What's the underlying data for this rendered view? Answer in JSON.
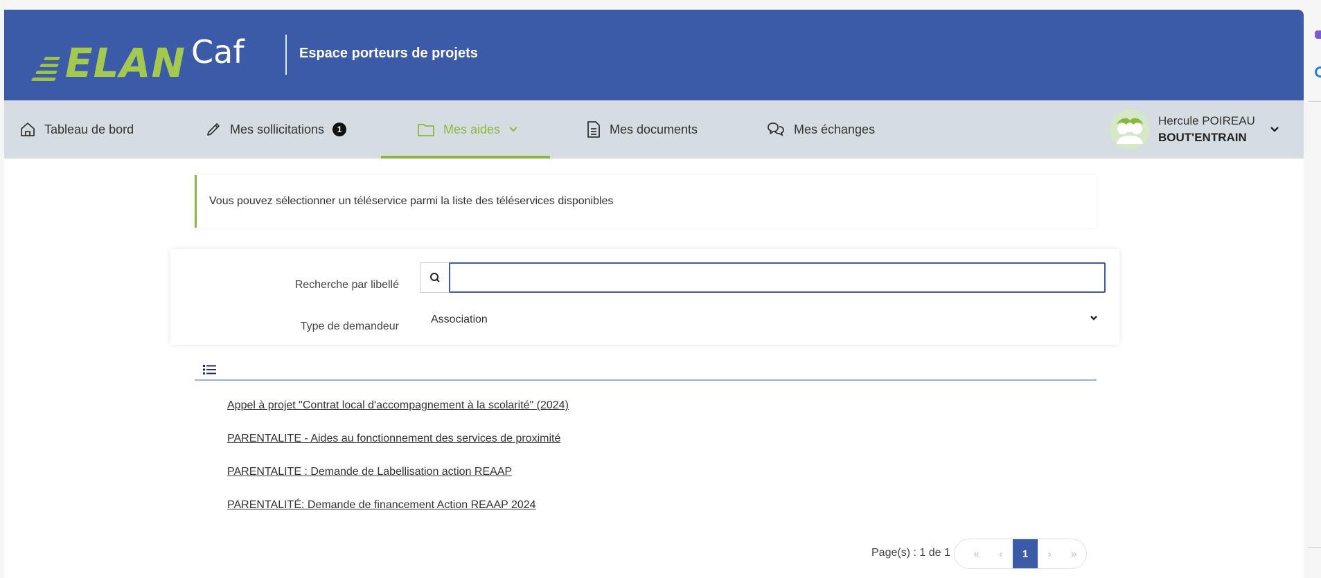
{
  "header": {
    "logo_elan": "ELAN",
    "logo_caf": "Caf",
    "title": "Espace porteurs de projets"
  },
  "nav": {
    "items": [
      {
        "label": "Tableau de bord",
        "icon": "home-icon"
      },
      {
        "label": "Mes sollicitations",
        "icon": "pen-icon",
        "badge": "1"
      },
      {
        "label": "Mes aides",
        "icon": "folder-icon",
        "active": true
      },
      {
        "label": "Mes documents",
        "icon": "document-icon"
      },
      {
        "label": "Mes échanges",
        "icon": "chat-icon"
      }
    ],
    "user": {
      "first_line": "Hercule POIREAU",
      "second_line": "BOUT'ENTRAIN"
    }
  },
  "info": {
    "message": "Vous pouvez sélectionner un téléservice parmi la liste des téléservices disponibles"
  },
  "search": {
    "label": "Recherche par libellé",
    "value": "",
    "type_label": "Type de demandeur",
    "type_value": "Association"
  },
  "list": {
    "items": [
      "Appel à projet \"Contrat local d'accompagnement à la scolarité\" (2024)",
      "PARENTALITE - Aides au fonctionnement des services de proximité",
      "PARENTALITE : Demande de Labellisation action REAAP",
      "PARENTALITÉ: Demande de financement Action REAAP 2024"
    ]
  },
  "pagination": {
    "text": "Page(s) : 1 de 1",
    "first": "«",
    "prev": "‹",
    "current": "1",
    "next": "›",
    "last": "»"
  },
  "colors": {
    "header_blue": "#3b5aa8",
    "accent_green": "#8bb73e",
    "nav_bg": "#d6dde2"
  }
}
